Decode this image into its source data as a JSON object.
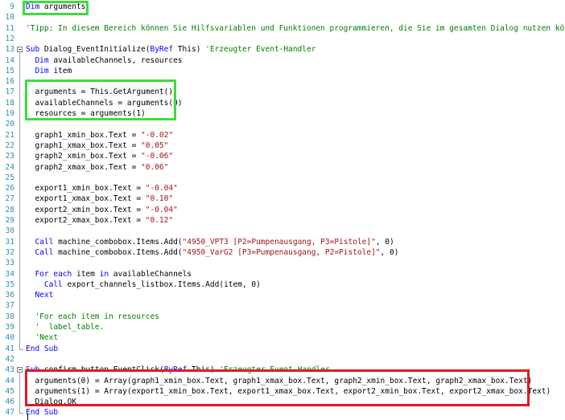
{
  "editor": {
    "lines": [
      {
        "n": "9",
        "t": "Dim arguments"
      },
      {
        "n": "10",
        "t": ""
      },
      {
        "n": "11",
        "t": "'Tipp: In diesem Bereich können Sie Hilfsvariablen und Funktionen programmieren, die Sie im gesamten Dialog nutzen können."
      },
      {
        "n": "12",
        "t": ""
      },
      {
        "n": "13",
        "t": "Sub Dialog_EventInitialize(ByRef This) 'Erzeugter Event-Handler"
      },
      {
        "n": "14",
        "t": "  Dim availableChannels, resources"
      },
      {
        "n": "15",
        "t": "  Dim item"
      },
      {
        "n": "16",
        "t": ""
      },
      {
        "n": "17",
        "t": "  arguments = This.GetArgument()"
      },
      {
        "n": "18",
        "t": "  availableChannels = arguments(0)"
      },
      {
        "n": "19",
        "t": "  resources = arguments(1)"
      },
      {
        "n": "20",
        "t": ""
      },
      {
        "n": "21",
        "t": "  graph1_xmin_box.Text = \"-0.02\""
      },
      {
        "n": "22",
        "t": "  graph1_xmax_box.Text = \"0.05\""
      },
      {
        "n": "23",
        "t": "  graph2_xmin_box.Text = \"-0.06\""
      },
      {
        "n": "24",
        "t": "  graph2_xmax_box.Text = \"0.06\""
      },
      {
        "n": "25",
        "t": ""
      },
      {
        "n": "26",
        "t": "  export1_xmin_box.Text = \"-0.04\""
      },
      {
        "n": "27",
        "t": "  export1_xmax_box.Text = \"0.10\""
      },
      {
        "n": "28",
        "t": "  export2_xmin_box.Text = \"-0.04\""
      },
      {
        "n": "29",
        "t": "  export2_xmax_box.Text = \"0.12\""
      },
      {
        "n": "30",
        "t": ""
      },
      {
        "n": "31",
        "t": "  Call machine_combobox.Items.Add(\"4950_VPT3 [P2=Pumpenausgang, P3=Pistole]\", 0)"
      },
      {
        "n": "32",
        "t": "  Call machine_combobox.Items.Add(\"4950_VarG2 [P3=Pumpenausgang, P2=Pistole]\", 0)"
      },
      {
        "n": "33",
        "t": ""
      },
      {
        "n": "34",
        "t": "  For each item in availableChannels"
      },
      {
        "n": "35",
        "t": "    Call export_channels_listbox.Items.Add(item, 0)"
      },
      {
        "n": "36",
        "t": "  Next"
      },
      {
        "n": "37",
        "t": ""
      },
      {
        "n": "38",
        "t": "  'For each item in resources"
      },
      {
        "n": "39",
        "t": "  '  label_table."
      },
      {
        "n": "40",
        "t": "  'Next"
      },
      {
        "n": "41",
        "t": "End Sub"
      },
      {
        "n": "42",
        "t": ""
      },
      {
        "n": "43",
        "t": "Sub confirm button EventClick(ByRef This) 'Erzeugter Event-Handler"
      },
      {
        "n": "44",
        "t": "  arguments(0) = Array(graph1_xmin_box.Text, graph1_xmax_box.Text, graph2_xmin_box.Text, graph2_xmax_box.Text)"
      },
      {
        "n": "45",
        "t": "  arguments(1) = Array(export1_xmin_box.Text, export1_xmax_box.Text, export2_xmin_box.Text, export2_xmax_box.Text)"
      },
      {
        "n": "46",
        "t": "  Dialog.OK"
      },
      {
        "n": "47",
        "t": "End Sub"
      }
    ]
  },
  "colors": {
    "keyword": "#0000ff",
    "comment": "#008000",
    "string": "#a31515",
    "line_number": "#2b91af",
    "highlight_green": "#3ddc3d",
    "highlight_red": "#e01b24"
  }
}
